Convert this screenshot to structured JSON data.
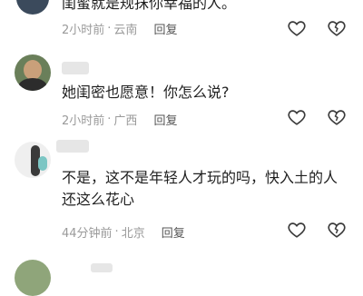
{
  "comments": [
    {
      "text": "闺蜜就是规抹你幸福的人。",
      "time": "2小时前",
      "location": "云南",
      "reply_label": "回复"
    },
    {
      "text": "她闺密也愿意！你怎么说?",
      "time": "2小时前",
      "location": "广西",
      "reply_label": "回复"
    },
    {
      "text_line1": "不是，这不是年轻人才玩的吗，快入土的人",
      "text_line2": "还这么花心",
      "time": "44分钟前",
      "location": "北京",
      "reply_label": "回复"
    }
  ],
  "separator": "·",
  "icons": [
    "heart-outline-icon",
    "broken-heart-icon"
  ]
}
